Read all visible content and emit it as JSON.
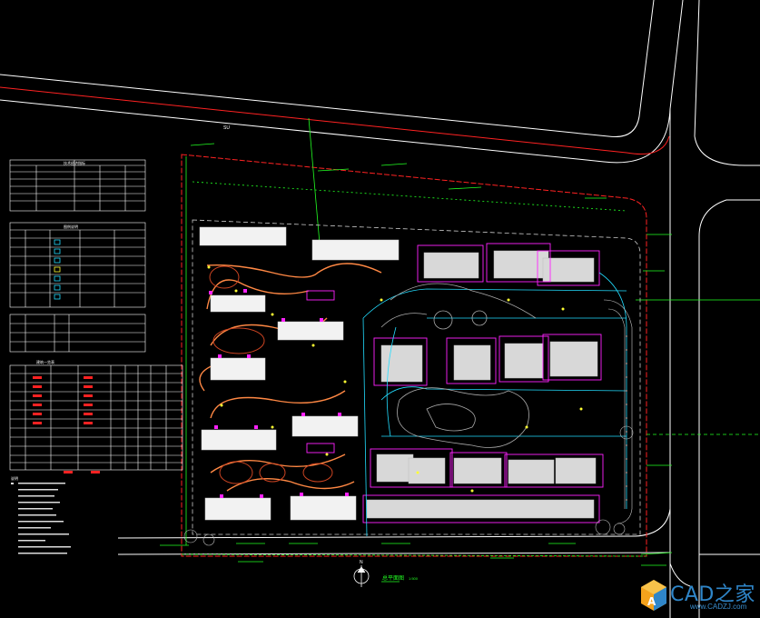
{
  "drawing": {
    "road_label": "SU",
    "plan_title": "总平面图",
    "scale": "1:500",
    "north_label": "N",
    "colors": {
      "background": "#000000",
      "road_line": "#ffffff",
      "red_line": "#ff2222",
      "green_annotation": "#22ff22",
      "magenta": "#ff22ff",
      "cyan": "#22ddff",
      "yellow": "#ffff33",
      "boundary_dashed": "#ffffff"
    }
  },
  "legend_tables": {
    "table1": {
      "title": "技术经济指标"
    },
    "table2": {
      "title": "图例说明"
    },
    "table3": {
      "title": "建筑一览表"
    },
    "notes_title": "说明"
  },
  "watermark": {
    "title": "CAD之家",
    "url": "www.CADZJ.com",
    "accent": "#2f86c9"
  }
}
